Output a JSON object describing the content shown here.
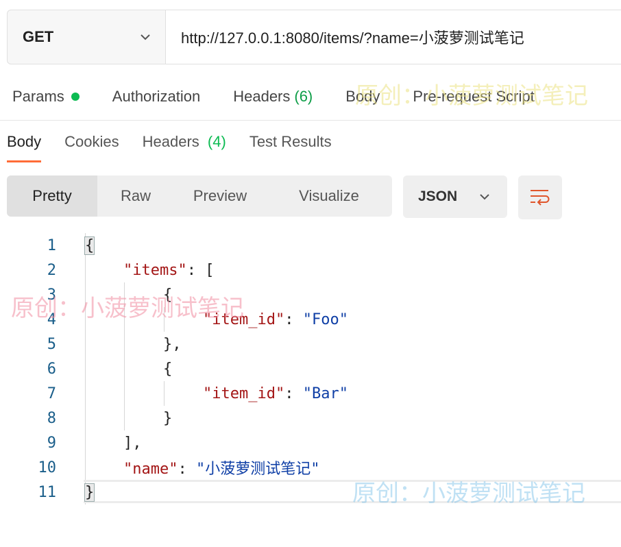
{
  "request": {
    "method": "GET",
    "url": "http://127.0.0.1:8080/items/?name=小菠萝测试笔记"
  },
  "request_tabs": {
    "params": "Params",
    "authorization": "Authorization",
    "headers": "Headers",
    "headers_count": "(6)",
    "body": "Body",
    "prerequest": "Pre-request Script"
  },
  "response_tabs": {
    "body": "Body",
    "cookies": "Cookies",
    "headers": "Headers",
    "headers_count": "(4)",
    "test_results": "Test Results"
  },
  "view_modes": {
    "pretty": "Pretty",
    "raw": "Raw",
    "preview": "Preview",
    "visualize": "Visualize"
  },
  "format": "JSON",
  "code": {
    "line_numbers": [
      "1",
      "2",
      "3",
      "4",
      "5",
      "6",
      "7",
      "8",
      "9",
      "10",
      "11"
    ],
    "l1": "{",
    "l2_key": "\"items\"",
    "l2_rest": ": [",
    "l3": "{",
    "l4_key": "\"item_id\"",
    "l4_sep": ": ",
    "l4_val": "\"Foo\"",
    "l5": "},",
    "l6": "{",
    "l7_key": "\"item_id\"",
    "l7_sep": ": ",
    "l7_val": "\"Bar\"",
    "l8": "}",
    "l9": "],",
    "l10_key": "\"name\"",
    "l10_sep": ": ",
    "l10_val": "\"小菠萝测试笔记\"",
    "l11": "}"
  },
  "watermarks": {
    "text1": "原创：小菠萝测试笔记",
    "text2": "原创：小菠萝测试笔记",
    "text3": "原创：小菠萝测试笔记"
  },
  "colors": {
    "accent": "#ff6c37",
    "status_green": "#0cbb52",
    "json_key": "#a31515",
    "json_string": "#0f3fa6"
  }
}
